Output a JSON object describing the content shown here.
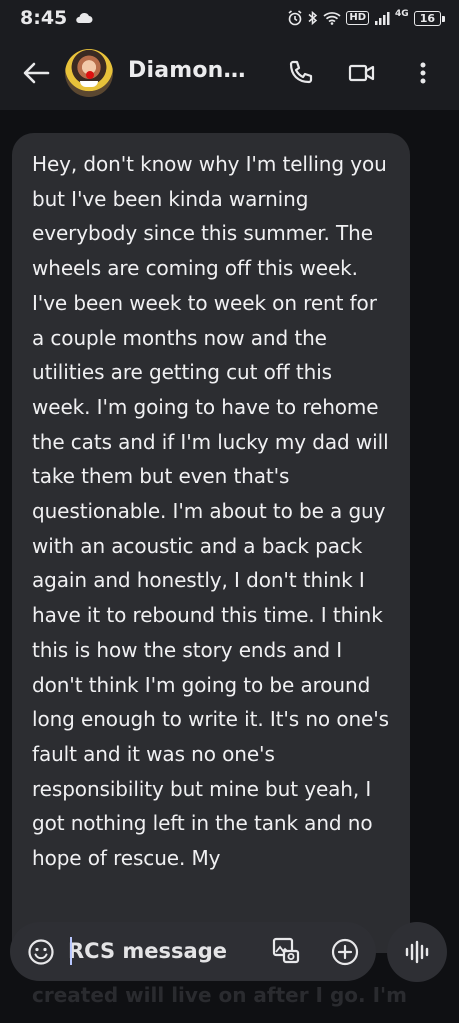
{
  "status_bar": {
    "time": "8:45",
    "hd": "HD",
    "network": "4G",
    "battery": "16"
  },
  "header": {
    "contact_name": "Diamon…",
    "icons": [
      "back-arrow-icon",
      "avatar",
      "phone-icon",
      "video-icon",
      "more-vert-icon"
    ]
  },
  "message": {
    "text": "Hey, don't know why I'm telling you but I've been kinda warning everybody since this summer. The wheels are coming off this week. I've been week to week on rent for a couple months now and the utilities are getting cut off this week. I'm going to have to rehome the cats and if I'm lucky my dad will take them but even that's questionable. I'm about to be a guy with an acoustic and a back pack again and honestly, I don't think I have it to rebound this time. I think this is how the story ends and I don't think I'm going to be around long enough to write it. It's no one's fault and it was no one's responsibility but mine but yeah, I got nothing left in the tank and no hope of rescue. My",
    "overflow_text": "created will live on after I go. I'm"
  },
  "composer": {
    "placeholder": "RCS message",
    "value": ""
  }
}
